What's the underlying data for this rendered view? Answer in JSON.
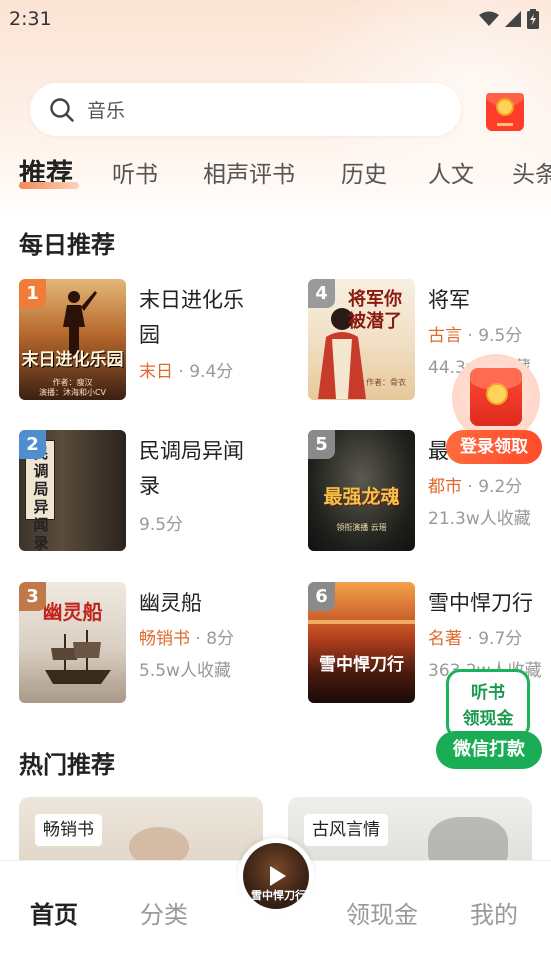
{
  "status_bar": {
    "time": "2:31"
  },
  "search": {
    "placeholder": "音乐"
  },
  "tabs": [
    {
      "label": "推荐",
      "active": true
    },
    {
      "label": "听书"
    },
    {
      "label": "相声评书"
    },
    {
      "label": "历史"
    },
    {
      "label": "人文"
    },
    {
      "label": "头条"
    }
  ],
  "daily": {
    "title": "每日推荐",
    "books": [
      {
        "rank": "1",
        "title": "末日进化乐园",
        "tag": "末日",
        "score": "9.4分",
        "stat": "",
        "cover_text": "末日进化乐园",
        "cover_author": "作者：瘦汉",
        "cover_reader": "演播：沐海和小CV"
      },
      {
        "rank": "4",
        "title": "将军",
        "tag": "古言",
        "score": "9.5分",
        "stat": "44.3w人收藏",
        "cover_text": "将军你被潜了",
        "cover_author": "作者：骨衣",
        "cover_reader": ""
      },
      {
        "rank": "2",
        "title": "民调局异闻录",
        "tag": "",
        "score": "9.5分",
        "stat": "",
        "cover_text": "民调局 异闻录",
        "cover_author": "",
        "cover_reader": ""
      },
      {
        "rank": "5",
        "title": "最强龙魂",
        "tag": "都市",
        "score": "9.2分",
        "stat": "21.3w人收藏",
        "cover_text": "最强龙魂",
        "cover_author": "领衔演播 云瑶",
        "cover_reader": ""
      },
      {
        "rank": "3",
        "title": "幽灵船",
        "tag": "畅销书",
        "score": "8分",
        "stat": "5.5w人收藏",
        "cover_text": "幽灵船",
        "cover_author": "",
        "cover_reader": ""
      },
      {
        "rank": "6",
        "title": "雪中悍刀行",
        "tag": "名著",
        "score": "9.7分",
        "stat": "363.2w人收藏",
        "cover_text": "雪中悍刀行",
        "cover_author": "",
        "cover_reader": ""
      }
    ]
  },
  "float_red": {
    "label": "登录领取"
  },
  "float_listen": {
    "line1": "听书",
    "line2": "领现金",
    "button": "微信打款"
  },
  "hot": {
    "title": "热门推荐",
    "cards": [
      {
        "tag": "畅销书"
      },
      {
        "tag": "古风言情"
      }
    ]
  },
  "nav": {
    "items": [
      {
        "label": "首页",
        "active": true
      },
      {
        "label": "分类"
      },
      {
        "label": "领现金"
      },
      {
        "label": "我的"
      }
    ],
    "mini_title": "雪中悍刀行"
  },
  "colors": {
    "accent": "#e0692e",
    "green": "#1aad55",
    "red": "#ff4b2c"
  }
}
